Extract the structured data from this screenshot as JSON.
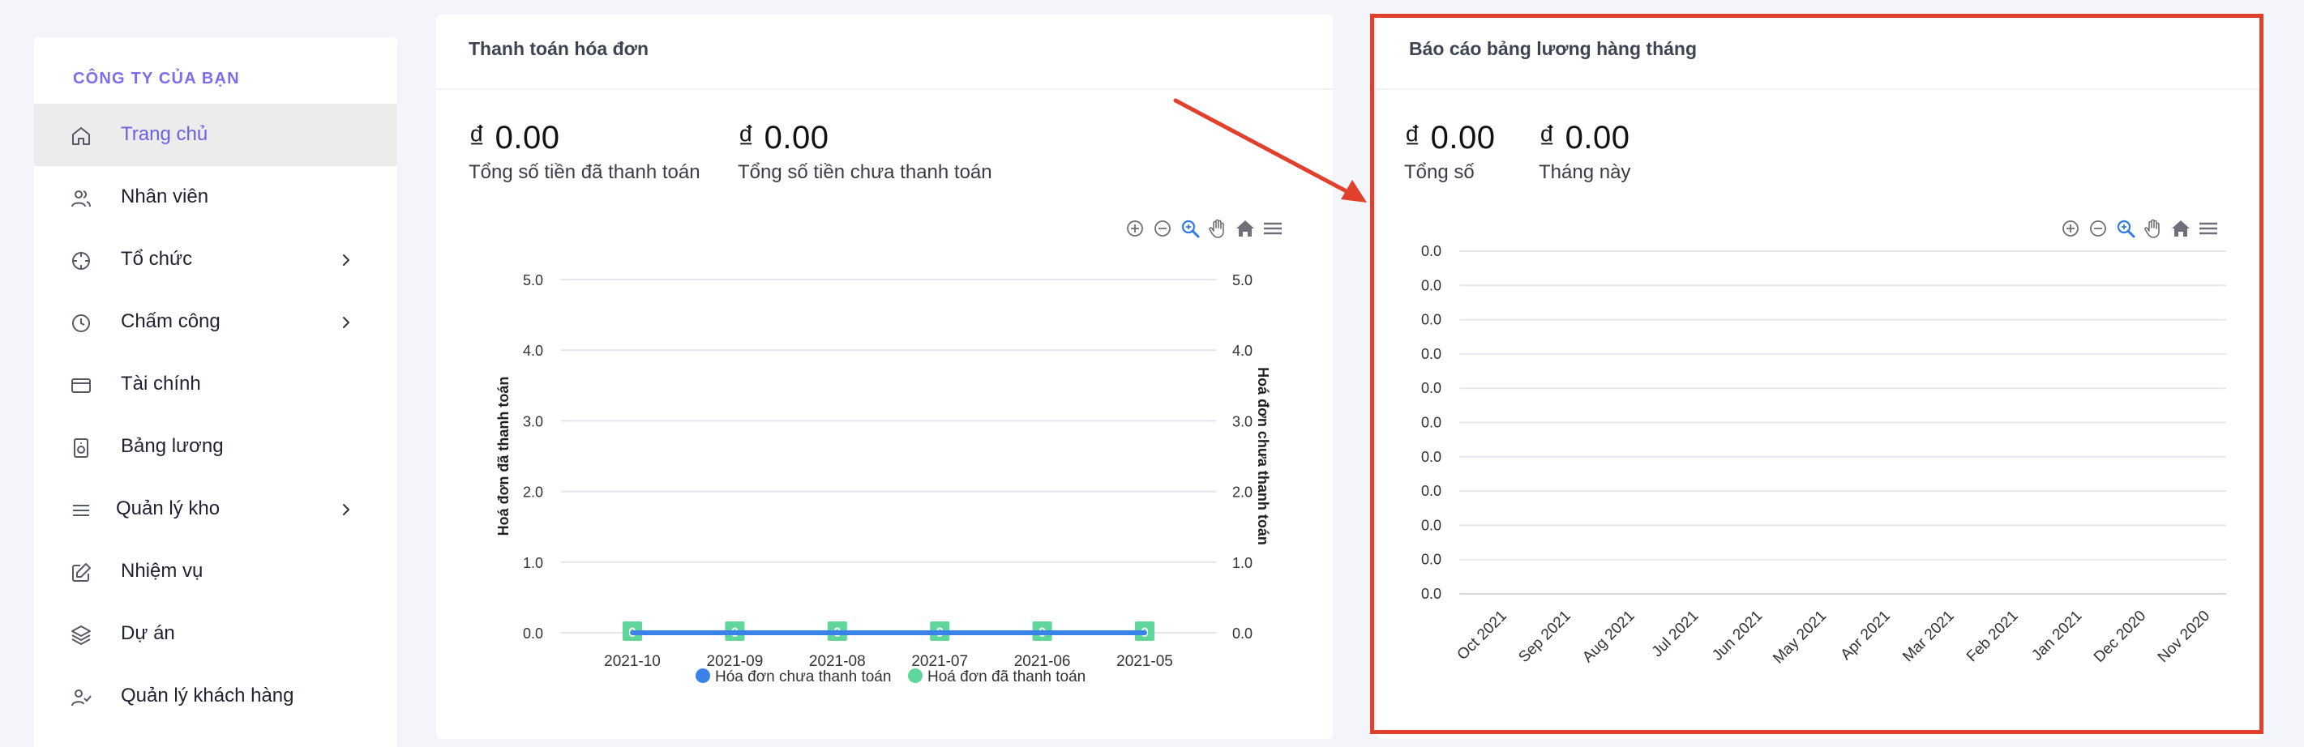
{
  "sidebar": {
    "company": "CÔNG TY CỦA BẠN",
    "items": [
      {
        "label": "Trang chủ",
        "icon": "home-icon",
        "active": true,
        "chevron": false
      },
      {
        "label": "Nhân viên",
        "icon": "users-icon",
        "active": false,
        "chevron": false
      },
      {
        "label": "Tổ chức",
        "icon": "crosshair-icon",
        "active": false,
        "chevron": true
      },
      {
        "label": "Chấm công",
        "icon": "clock-icon",
        "active": false,
        "chevron": true
      },
      {
        "label": "Tài chính",
        "icon": "credit-card-icon",
        "active": false,
        "chevron": false
      },
      {
        "label": "Bảng lương",
        "icon": "speaker-icon",
        "active": false,
        "chevron": false
      },
      {
        "label": "Quản lý kho",
        "icon": "menu-icon",
        "active": false,
        "chevron": true
      },
      {
        "label": "Nhiệm vụ",
        "icon": "edit-icon",
        "active": false,
        "chevron": false
      },
      {
        "label": "Dự án",
        "icon": "layers-icon",
        "active": false,
        "chevron": false
      },
      {
        "label": "Quản lý khách hàng",
        "icon": "user-check-icon",
        "active": false,
        "chevron": false
      }
    ]
  },
  "invoice_card": {
    "title": "Thanh toán hóa đơn",
    "stats": [
      {
        "value": "₫ 0.00",
        "label": "Tổng số tiền đã thanh toán"
      },
      {
        "value": "₫ 0.00",
        "label": "Tổng số tiền chưa thanh toán"
      }
    ]
  },
  "payroll_card": {
    "title": "Báo cáo bảng lương hàng tháng",
    "stats": [
      {
        "value": "₫ 0.00",
        "label": "Tổng số"
      },
      {
        "value": "₫ 0.00",
        "label": "Tháng này"
      }
    ]
  },
  "colors": {
    "accent": "#6b5fe6",
    "highlight": "#e0402c",
    "series_paid": "#5fd69a",
    "series_unpaid": "#3b82e8"
  },
  "chart_data": [
    {
      "type": "line",
      "categories": [
        "2021-10",
        "2021-09",
        "2021-08",
        "2021-07",
        "2021-06",
        "2021-05"
      ],
      "series": [
        {
          "name": "Hóa đơn chưa thanh toán",
          "values": [
            0,
            0,
            0,
            0,
            0,
            0
          ],
          "axis": "right",
          "color": "#3b82e8"
        },
        {
          "name": "Hoá đơn đã thanh toán",
          "values": [
            0,
            0,
            0,
            0,
            0,
            0
          ],
          "axis": "left",
          "color": "#5fd69a",
          "data_labels": [
            "0",
            "0",
            "0",
            "0",
            "0",
            "0"
          ]
        }
      ],
      "ylabel": "Hoá đơn đã thanh toán",
      "ylabel_right": "Hoá đơn chưa thanh toán",
      "ylim": [
        0,
        5
      ],
      "yticks": [
        "0.0",
        "1.0",
        "2.0",
        "3.0",
        "4.0",
        "5.0"
      ],
      "yticks_right": [
        "0.0",
        "1.0",
        "2.0",
        "3.0",
        "4.0",
        "5.0"
      ],
      "grid": true,
      "legend": "bottom"
    },
    {
      "type": "bar",
      "categories": [
        "Oct 2021",
        "Sep 2021",
        "Aug 2021",
        "Jul 2021",
        "Jun 2021",
        "May 2021",
        "Apr 2021",
        "Mar 2021",
        "Feb 2021",
        "Jan 2021",
        "Dec 2020",
        "Nov 2020"
      ],
      "values": [
        0,
        0,
        0,
        0,
        0,
        0,
        0,
        0,
        0,
        0,
        0,
        0
      ],
      "yticks": [
        "0.0",
        "0.0",
        "0.0",
        "0.0",
        "0.0",
        "0.0",
        "0.0",
        "0.0",
        "0.0",
        "0.0",
        "0.0"
      ],
      "grid": true
    }
  ]
}
